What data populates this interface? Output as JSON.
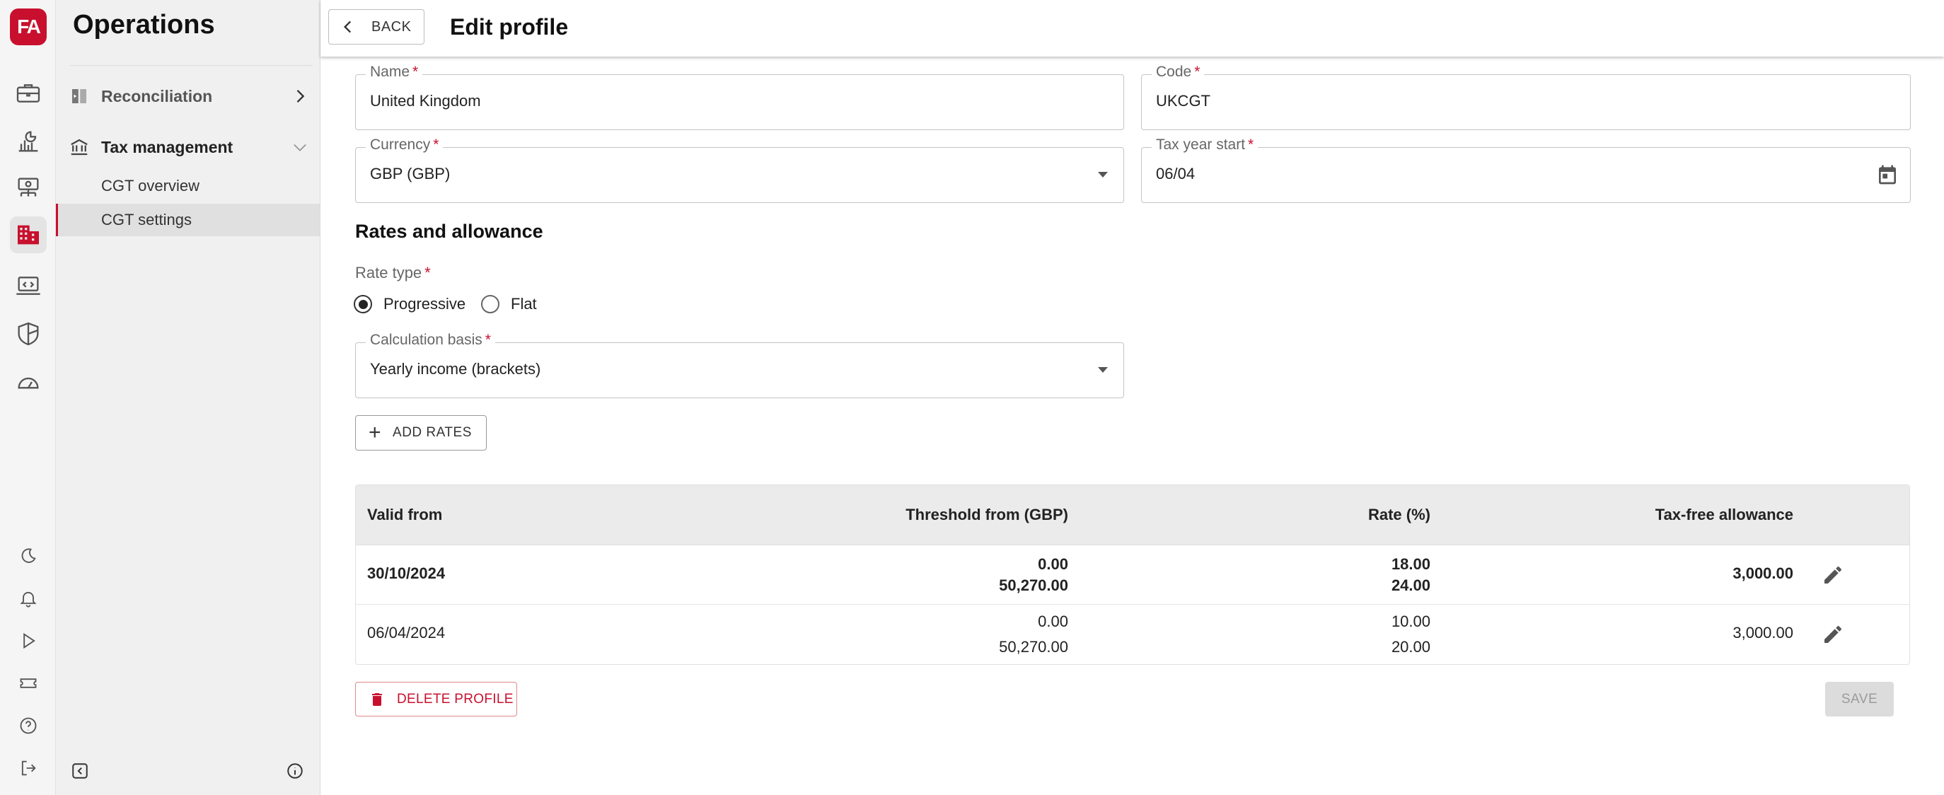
{
  "app": {
    "logo_text": "FA",
    "brand_color": "#c8102e"
  },
  "rail": {
    "icons": [
      "briefcase-icon",
      "chart-icon",
      "money-flow-icon",
      "building-icon",
      "code-screen-icon",
      "shield-icon",
      "dashboard-icon"
    ],
    "active": "building-icon",
    "bottom_icons": [
      "moon-icon",
      "bell-icon",
      "play-icon",
      "ticket-icon",
      "help-icon",
      "logout-icon"
    ]
  },
  "sidebar": {
    "title": "Operations",
    "groups": [
      {
        "label": "Reconciliation",
        "expanded": false
      },
      {
        "label": "Tax management",
        "expanded": true,
        "items": [
          {
            "label": "CGT overview",
            "active": false
          },
          {
            "label": "CGT settings",
            "active": true
          }
        ]
      }
    ]
  },
  "header": {
    "back_label": "BACK",
    "title": "Edit profile"
  },
  "form": {
    "required_mark": "*",
    "name": {
      "label": "Name",
      "value": "United Kingdom"
    },
    "code": {
      "label": "Code",
      "value": "UKCGT"
    },
    "currency": {
      "label": "Currency",
      "value": "GBP (GBP)"
    },
    "tax_year_start": {
      "label": "Tax year start",
      "value": "06/04"
    },
    "section_title": "Rates and allowance",
    "rate_type": {
      "label": "Rate type",
      "options": [
        "Progressive",
        "Flat"
      ],
      "selected": "Progressive"
    },
    "calculation_basis": {
      "label": "Calculation basis",
      "value": "Yearly income (brackets)"
    },
    "add_rates_label": "ADD RATES"
  },
  "table": {
    "columns": [
      "Valid from",
      "Threshold from (GBP)",
      "Rate (%)",
      "Tax-free allowance"
    ],
    "rows": [
      {
        "valid_from": "30/10/2024",
        "thresholds": [
          "0.00",
          "50,270.00"
        ],
        "rates": [
          "18.00",
          "24.00"
        ],
        "allowance": "3,000.00",
        "bold": true
      },
      {
        "valid_from": "06/04/2024",
        "thresholds": [
          "0.00",
          "50,270.00"
        ],
        "rates": [
          "10.00",
          "20.00"
        ],
        "allowance": "3,000.00",
        "bold": false
      }
    ]
  },
  "actions": {
    "delete_label": "DELETE PROFILE",
    "save_label": "SAVE"
  }
}
